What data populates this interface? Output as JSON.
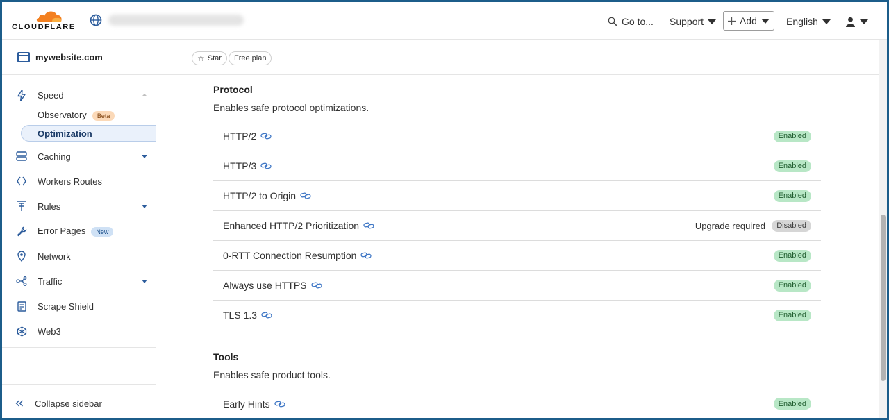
{
  "topbar": {
    "logo_text": "CLOUDFLARE",
    "search_label": "Go to...",
    "support_label": "Support",
    "add_label": "Add",
    "language_label": "English"
  },
  "zone": {
    "name": "mywebsite.com",
    "star_label": "Star",
    "plan_label": "Free plan"
  },
  "sidebar": {
    "speed": "Speed",
    "observatory": "Observatory",
    "observatory_badge": "Beta",
    "optimization": "Optimization",
    "caching": "Caching",
    "workers_routes": "Workers Routes",
    "rules": "Rules",
    "error_pages": "Error Pages",
    "error_pages_badge": "New",
    "network": "Network",
    "traffic": "Traffic",
    "scrape_shield": "Scrape Shield",
    "web3": "Web3",
    "collapse": "Collapse sidebar"
  },
  "protocol": {
    "title": "Protocol",
    "description": "Enables safe protocol optimizations.",
    "rows": [
      {
        "label": "HTTP/2",
        "status": "Enabled"
      },
      {
        "label": "HTTP/3",
        "status": "Enabled"
      },
      {
        "label": "HTTP/2 to Origin",
        "status": "Enabled"
      },
      {
        "label": "Enhanced HTTP/2 Prioritization",
        "status": "Disabled",
        "note": "Upgrade required"
      },
      {
        "label": "0-RTT Connection Resumption",
        "status": "Enabled"
      },
      {
        "label": "Always use HTTPS",
        "status": "Enabled"
      },
      {
        "label": "TLS 1.3",
        "status": "Enabled"
      }
    ]
  },
  "tools": {
    "title": "Tools",
    "description": "Enables safe product tools.",
    "rows": [
      {
        "label": "Early Hints",
        "status": "Enabled"
      }
    ]
  },
  "colors": {
    "accent": "#2c5c9c",
    "logo_orange": "#f38020",
    "enabled_bg": "#b8e7c6",
    "disabled_bg": "#d6d6d6"
  }
}
